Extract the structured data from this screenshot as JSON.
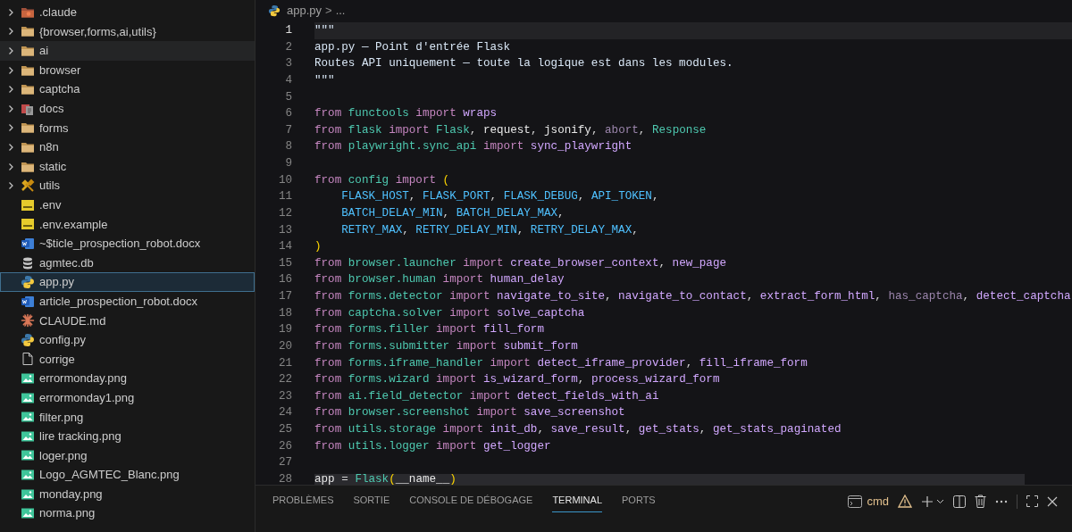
{
  "explorer": {
    "items": [
      {
        "label": ".claude",
        "kind": "claudefolder",
        "expanded": false,
        "selected": false,
        "hovered": false
      },
      {
        "label": "{browser,forms,ai,utils}",
        "kind": "folder",
        "expanded": false,
        "selected": false,
        "hovered": false
      },
      {
        "label": "ai",
        "kind": "folder",
        "expanded": false,
        "selected": false,
        "hovered": true
      },
      {
        "label": "browser",
        "kind": "folder",
        "expanded": false,
        "selected": false,
        "hovered": false
      },
      {
        "label": "captcha",
        "kind": "folder",
        "expanded": false,
        "selected": false,
        "hovered": false
      },
      {
        "label": "docs",
        "kind": "docsfolder",
        "expanded": false,
        "selected": false,
        "hovered": false
      },
      {
        "label": "forms",
        "kind": "folder",
        "expanded": false,
        "selected": false,
        "hovered": false
      },
      {
        "label": "n8n",
        "kind": "folder",
        "expanded": false,
        "selected": false,
        "hovered": false
      },
      {
        "label": "static",
        "kind": "folder",
        "expanded": false,
        "selected": false,
        "hovered": false
      },
      {
        "label": "utils",
        "kind": "toolsfolder",
        "expanded": false,
        "selected": false,
        "hovered": false
      },
      {
        "label": ".env",
        "kind": "env",
        "selected": false,
        "hovered": false
      },
      {
        "label": ".env.example",
        "kind": "env",
        "selected": false,
        "hovered": false
      },
      {
        "label": "~$ticle_prospection_robot.docx",
        "kind": "word",
        "selected": false,
        "hovered": false
      },
      {
        "label": "agmtec.db",
        "kind": "database",
        "selected": false,
        "hovered": false
      },
      {
        "label": "app.py",
        "kind": "python",
        "selected": true,
        "hovered": false
      },
      {
        "label": "article_prospection_robot.docx",
        "kind": "word",
        "selected": false,
        "hovered": false
      },
      {
        "label": "CLAUDE.md",
        "kind": "claude",
        "selected": false,
        "hovered": false
      },
      {
        "label": "config.py",
        "kind": "python",
        "selected": false,
        "hovered": false
      },
      {
        "label": "corrige",
        "kind": "plain",
        "selected": false,
        "hovered": false
      },
      {
        "label": "errormonday.png",
        "kind": "image",
        "selected": false,
        "hovered": false
      },
      {
        "label": "errormonday1.png",
        "kind": "image",
        "selected": false,
        "hovered": false
      },
      {
        "label": "filter.png",
        "kind": "image",
        "selected": false,
        "hovered": false
      },
      {
        "label": "lire tracking.png",
        "kind": "image",
        "selected": false,
        "hovered": false
      },
      {
        "label": "loger.png",
        "kind": "image",
        "selected": false,
        "hovered": false
      },
      {
        "label": "Logo_AGMTEC_Blanc.png",
        "kind": "image",
        "selected": false,
        "hovered": false
      },
      {
        "label": "monday.png",
        "kind": "image",
        "selected": false,
        "hovered": false
      },
      {
        "label": "norma.png",
        "kind": "image",
        "selected": false,
        "hovered": false
      }
    ]
  },
  "breadcrumb": {
    "file": "app.py",
    "separator": ">",
    "more": "..."
  },
  "editor": {
    "lines": [
      {
        "number": "1",
        "current": true,
        "tokens": [
          {
            "kind": "docstring",
            "text": "\"\"\""
          }
        ]
      },
      {
        "number": "2",
        "current": false,
        "tokens": [
          {
            "kind": "docstring",
            "text": "app.py — Point d'entrée Flask"
          }
        ]
      },
      {
        "number": "3",
        "current": false,
        "tokens": [
          {
            "kind": "docstring",
            "text": "Routes API uniquement — toute la logique est dans les modules."
          }
        ]
      },
      {
        "number": "4",
        "current": false,
        "tokens": [
          {
            "kind": "docstring",
            "text": "\"\"\""
          }
        ]
      },
      {
        "number": "5",
        "current": false
      },
      {
        "number": "6",
        "current": false,
        "tokens": [
          {
            "kind": "keyword",
            "text": "from"
          },
          {
            "kind": "module",
            "text": " functools"
          },
          {
            "kind": "keyword",
            "text": " import"
          },
          {
            "kind": "function",
            "text": " wraps"
          }
        ]
      },
      {
        "number": "7",
        "current": false,
        "tokens": [
          {
            "kind": "keyword",
            "text": "from"
          },
          {
            "kind": "module",
            "text": " flask"
          },
          {
            "kind": "keyword",
            "text": " import"
          },
          {
            "kind": "class",
            "text": " Flask"
          },
          {
            "kind": "punctuation",
            "text": ","
          },
          {
            "kind": "variable",
            "text": " request"
          },
          {
            "kind": "punctuation",
            "text": ","
          },
          {
            "kind": "variable",
            "text": " jsonify"
          },
          {
            "kind": "punctuation",
            "text": ","
          },
          {
            "kind": "unused",
            "text": " abort"
          },
          {
            "kind": "punctuation",
            "text": ","
          },
          {
            "kind": "class",
            "text": " Response"
          }
        ]
      },
      {
        "number": "8",
        "current": false,
        "tokens": [
          {
            "kind": "keyword",
            "text": "from"
          },
          {
            "kind": "module",
            "text": " playwright.sync_api"
          },
          {
            "kind": "keyword",
            "text": " import"
          },
          {
            "kind": "function",
            "text": " sync_playwright"
          }
        ]
      },
      {
        "number": "9",
        "current": false
      },
      {
        "number": "10",
        "current": false,
        "tokens": [
          {
            "kind": "keyword",
            "text": "from"
          },
          {
            "kind": "module",
            "text": " config"
          },
          {
            "kind": "keyword",
            "text": " import"
          },
          {
            "kind": "bracket",
            "text": " ("
          }
        ]
      },
      {
        "number": "11",
        "current": false,
        "tokens": [
          {
            "kind": "constant",
            "text": "    FLASK_HOST"
          },
          {
            "kind": "punctuation",
            "text": ","
          },
          {
            "kind": "constant",
            "text": " FLASK_PORT"
          },
          {
            "kind": "punctuation",
            "text": ","
          },
          {
            "kind": "constant",
            "text": " FLASK_DEBUG"
          },
          {
            "kind": "punctuation",
            "text": ","
          },
          {
            "kind": "constant",
            "text": " API_TOKEN"
          },
          {
            "kind": "punctuation",
            "text": ","
          }
        ]
      },
      {
        "number": "12",
        "current": false,
        "tokens": [
          {
            "kind": "constant",
            "text": "    BATCH_DELAY_MIN"
          },
          {
            "kind": "punctuation",
            "text": ","
          },
          {
            "kind": "constant",
            "text": " BATCH_DELAY_MAX"
          },
          {
            "kind": "punctuation",
            "text": ","
          }
        ]
      },
      {
        "number": "13",
        "current": false,
        "tokens": [
          {
            "kind": "constant",
            "text": "    RETRY_MAX"
          },
          {
            "kind": "punctuation",
            "text": ","
          },
          {
            "kind": "constant",
            "text": " RETRY_DELAY_MIN"
          },
          {
            "kind": "punctuation",
            "text": ","
          },
          {
            "kind": "constant",
            "text": " RETRY_DELAY_MAX"
          },
          {
            "kind": "punctuation",
            "text": ","
          }
        ]
      },
      {
        "number": "14",
        "current": false,
        "tokens": [
          {
            "kind": "bracket",
            "text": ")"
          }
        ]
      },
      {
        "number": "15",
        "current": false,
        "tokens": [
          {
            "kind": "keyword",
            "text": "from"
          },
          {
            "kind": "module",
            "text": " browser.launcher"
          },
          {
            "kind": "keyword",
            "text": " import"
          },
          {
            "kind": "function",
            "text": " create_browser_context"
          },
          {
            "kind": "punctuation",
            "text": ","
          },
          {
            "kind": "function",
            "text": " new_page"
          }
        ]
      },
      {
        "number": "16",
        "current": false,
        "tokens": [
          {
            "kind": "keyword",
            "text": "from"
          },
          {
            "kind": "module",
            "text": " browser.human"
          },
          {
            "kind": "keyword",
            "text": " import"
          },
          {
            "kind": "function",
            "text": " human_delay"
          }
        ]
      },
      {
        "number": "17",
        "current": false,
        "tokens": [
          {
            "kind": "keyword",
            "text": "from"
          },
          {
            "kind": "module",
            "text": " forms.detector"
          },
          {
            "kind": "keyword",
            "text": " import"
          },
          {
            "kind": "function",
            "text": " navigate_to_site"
          },
          {
            "kind": "punctuation",
            "text": ","
          },
          {
            "kind": "function",
            "text": " navigate_to_contact"
          },
          {
            "kind": "punctuation",
            "text": ","
          },
          {
            "kind": "function",
            "text": " extract_form_html"
          },
          {
            "kind": "punctuation",
            "text": ","
          },
          {
            "kind": "unused",
            "text": " has_captcha"
          },
          {
            "kind": "punctuation",
            "text": ","
          },
          {
            "kind": "function",
            "text": " detect_captcha"
          }
        ]
      },
      {
        "number": "18",
        "current": false,
        "tokens": [
          {
            "kind": "keyword",
            "text": "from"
          },
          {
            "kind": "module",
            "text": " captcha.solver"
          },
          {
            "kind": "keyword",
            "text": " import"
          },
          {
            "kind": "function",
            "text": " solve_captcha"
          }
        ]
      },
      {
        "number": "19",
        "current": false,
        "tokens": [
          {
            "kind": "keyword",
            "text": "from"
          },
          {
            "kind": "module",
            "text": " forms.filler"
          },
          {
            "kind": "keyword",
            "text": " import"
          },
          {
            "kind": "function",
            "text": " fill_form"
          }
        ]
      },
      {
        "number": "20",
        "current": false,
        "tokens": [
          {
            "kind": "keyword",
            "text": "from"
          },
          {
            "kind": "module",
            "text": " forms.submitter"
          },
          {
            "kind": "keyword",
            "text": " import"
          },
          {
            "kind": "function",
            "text": " submit_form"
          }
        ]
      },
      {
        "number": "21",
        "current": false,
        "tokens": [
          {
            "kind": "keyword",
            "text": "from"
          },
          {
            "kind": "module",
            "text": " forms.iframe_handler"
          },
          {
            "kind": "keyword",
            "text": " import"
          },
          {
            "kind": "function",
            "text": " detect_iframe_provider"
          },
          {
            "kind": "punctuation",
            "text": ","
          },
          {
            "kind": "function",
            "text": " fill_iframe_form"
          }
        ]
      },
      {
        "number": "22",
        "current": false,
        "tokens": [
          {
            "kind": "keyword",
            "text": "from"
          },
          {
            "kind": "module",
            "text": " forms.wizard"
          },
          {
            "kind": "keyword",
            "text": " import"
          },
          {
            "kind": "function",
            "text": " is_wizard_form"
          },
          {
            "kind": "punctuation",
            "text": ","
          },
          {
            "kind": "function",
            "text": " process_wizard_form"
          }
        ]
      },
      {
        "number": "23",
        "current": false,
        "tokens": [
          {
            "kind": "keyword",
            "text": "from"
          },
          {
            "kind": "module",
            "text": " ai.field_detector"
          },
          {
            "kind": "keyword",
            "text": " import"
          },
          {
            "kind": "function",
            "text": " detect_fields_with_ai"
          }
        ]
      },
      {
        "number": "24",
        "current": false,
        "tokens": [
          {
            "kind": "keyword",
            "text": "from"
          },
          {
            "kind": "module",
            "text": " browser.screenshot"
          },
          {
            "kind": "keyword",
            "text": " import"
          },
          {
            "kind": "function",
            "text": " save_screenshot"
          }
        ]
      },
      {
        "number": "25",
        "current": false,
        "tokens": [
          {
            "kind": "keyword",
            "text": "from"
          },
          {
            "kind": "module",
            "text": " utils.storage"
          },
          {
            "kind": "keyword",
            "text": " import"
          },
          {
            "kind": "function",
            "text": " init_db"
          },
          {
            "kind": "punctuation",
            "text": ","
          },
          {
            "kind": "function",
            "text": " save_result"
          },
          {
            "kind": "punctuation",
            "text": ","
          },
          {
            "kind": "function",
            "text": " get_stats"
          },
          {
            "kind": "punctuation",
            "text": ","
          },
          {
            "kind": "function",
            "text": " get_stats_paginated"
          }
        ]
      },
      {
        "number": "26",
        "current": false,
        "tokens": [
          {
            "kind": "keyword",
            "text": "from"
          },
          {
            "kind": "module",
            "text": " utils.logger"
          },
          {
            "kind": "keyword",
            "text": " import"
          },
          {
            "kind": "function",
            "text": " get_logger"
          }
        ]
      },
      {
        "number": "27",
        "current": false
      },
      {
        "number": "28",
        "current": false,
        "tokens": [
          {
            "kind": "variable",
            "text": "app"
          },
          {
            "kind": "punctuation",
            "text": " = "
          },
          {
            "kind": "class",
            "text": "Flask"
          },
          {
            "kind": "bracket",
            "text": "("
          },
          {
            "kind": "variable",
            "text": "__name__"
          },
          {
            "kind": "bracket",
            "text": ")"
          }
        ]
      }
    ]
  },
  "panel": {
    "tabs": [
      {
        "label": "PROBLÈMES",
        "selected": false
      },
      {
        "label": "SORTIE",
        "selected": false
      },
      {
        "label": "CONSOLE DE DÉBOGAGE",
        "selected": false
      },
      {
        "label": "TERMINAL",
        "selected": true
      },
      {
        "label": "PORTS",
        "selected": false
      }
    ],
    "terminal_name": "cmd"
  }
}
